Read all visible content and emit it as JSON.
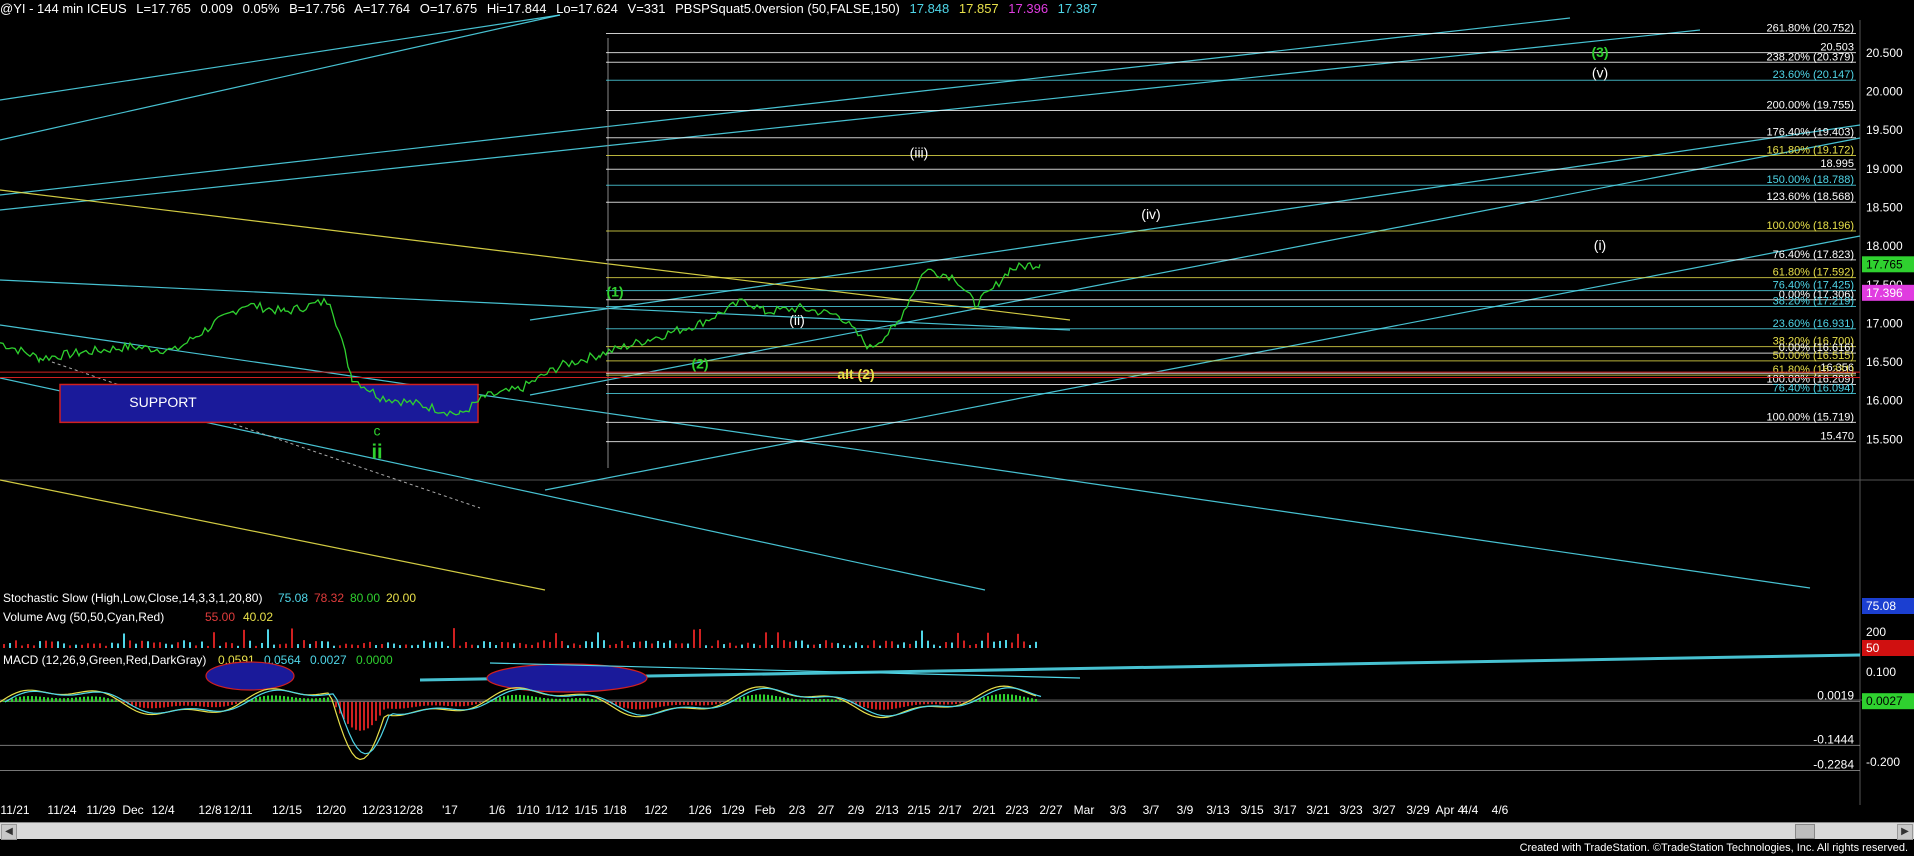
{
  "header": {
    "symbol": "@YI - 144 min  ICEUS",
    "last": "L=17.765",
    "change": "0.009",
    "pct": "0.05%",
    "bid": "B=17.756",
    "ask": "A=17.764",
    "open": "O=17.675",
    "high": "Hi=17.844",
    "low": "Lo=17.624",
    "volume": "V=331",
    "study": "PBSPSquat5.0version (50,FALSE,150)",
    "v1": "17.848",
    "v2": "17.857",
    "v3": "17.396",
    "v4": "17.387"
  },
  "colors": {
    "background": "#000000",
    "cyan": "#4fd6e8",
    "yellow": "#e8e04a",
    "olive": "#c8b85a",
    "green": "#2fd12f",
    "magenta": "#e03ce0",
    "red": "#d02020",
    "blue_box": "#1a1a9a",
    "white": "#ffffff"
  },
  "chart_data": [
    {
      "type": "line",
      "panel": "price",
      "y_axis_labels": [
        "20.500",
        "20.000",
        "19.500",
        "19.000",
        "18.500",
        "18.000",
        "17.500",
        "17.000",
        "16.500",
        "16.000",
        "15.500"
      ],
      "ylim": [
        15.0,
        20.9
      ],
      "x_labels": [
        "11/21",
        "11/24",
        "11/29",
        "Dec",
        "12/4",
        "12/8",
        "12/11",
        "12/15",
        "12/20",
        "12/23",
        "12/28",
        "'17",
        "1/6",
        "1/10",
        "1/12",
        "1/15",
        "1/18",
        "1/22",
        "1/26",
        "1/29",
        "Feb",
        "2/3",
        "2/7",
        "2/9",
        "2/13",
        "2/15",
        "2/17",
        "2/21",
        "2/23",
        "2/27",
        "Mar",
        "3/3",
        "3/7",
        "3/9",
        "3/13",
        "3/15",
        "3/17",
        "3/21",
        "3/23",
        "3/27",
        "3/29",
        "Apr 4",
        "4/4",
        "4/6"
      ],
      "fib_levels": [
        {
          "label": "261.80% (20.752)",
          "value": 20.752,
          "color": "#ffffff"
        },
        {
          "label": "20.503",
          "value": 20.503,
          "color": "#ffffff"
        },
        {
          "label": "238.20% (20.379)",
          "value": 20.379,
          "color": "#ffffff"
        },
        {
          "label": "23.60% (20.147)",
          "value": 20.147,
          "color": "#4fd6e8"
        },
        {
          "label": "200.00% (19.755)",
          "value": 19.755,
          "color": "#ffffff"
        },
        {
          "label": "176.40% (19.403)",
          "value": 19.403,
          "color": "#ffffff"
        },
        {
          "label": "161.80% (19.172)",
          "value": 19.172,
          "color": "#e8e04a"
        },
        {
          "label": "18.995",
          "value": 18.995,
          "color": "#ffffff"
        },
        {
          "label": "150.00% (18.788)",
          "value": 18.788,
          "color": "#4fd6e8"
        },
        {
          "label": "123.60% (18.568)",
          "value": 18.568,
          "color": "#ffffff"
        },
        {
          "label": "100.00% (18.196)",
          "value": 18.196,
          "color": "#e8e04a"
        },
        {
          "label": "76.40% (17.823)",
          "value": 17.823,
          "color": "#ffffff"
        },
        {
          "label": "61.80% (17.592)",
          "value": 17.592,
          "color": "#e8e04a"
        },
        {
          "label": "76.40% (17.425)",
          "value": 17.425,
          "color": "#4fd6e8"
        },
        {
          "label": "0.00% (17.306)",
          "value": 17.306,
          "color": "#ffffff"
        },
        {
          "label": "38.20% (17.219)",
          "value": 17.219,
          "color": "#4fd6e8"
        },
        {
          "label": "23.60% (16.931)",
          "value": 16.931,
          "color": "#4fd6e8"
        },
        {
          "label": "38.20% (16.700)",
          "value": 16.7,
          "color": "#e8e04a"
        },
        {
          "label": "0.00% (16.616)",
          "value": 16.616,
          "color": "#ffffff"
        },
        {
          "label": "50.00% (16.515)",
          "value": 16.515,
          "color": "#e8e04a"
        },
        {
          "label": "16.356",
          "value": 16.356,
          "color": "#ffffff"
        },
        {
          "label": "61.80% (16.331)",
          "value": 16.331,
          "color": "#e8e04a"
        },
        {
          "label": "100.00% (16.209)",
          "value": 16.209,
          "color": "#ffffff"
        },
        {
          "label": "76.40% (16.094)",
          "value": 16.094,
          "color": "#4fd6e8"
        },
        {
          "label": "100.00% (15.719)",
          "value": 15.719,
          "color": "#ffffff"
        },
        {
          "label": "15.470",
          "value": 15.47,
          "color": "#ffffff"
        }
      ],
      "price_tags": [
        {
          "label": "17.765",
          "value": 17.765,
          "bg": "#2fd12f",
          "fg": "#000000"
        },
        {
          "label": "17.396",
          "value": 17.396,
          "bg": "#e03ce0",
          "fg": "#ffffff"
        }
      ],
      "annotations": [
        {
          "text": "(3)",
          "color": "#2fd12f",
          "x_date": "4/2",
          "y": 20.45
        },
        {
          "text": "(v)",
          "color": "#ffffff",
          "x_date": "4/2",
          "y": 20.18
        },
        {
          "text": "(iii)",
          "color": "#ffffff",
          "x_date": "2/15",
          "y": 19.15
        },
        {
          "text": "(iv)",
          "color": "#ffffff",
          "x_date": "3/7",
          "y": 18.35
        },
        {
          "text": "(i)",
          "color": "#ffffff",
          "x_date": "1/30",
          "y": 17.95
        },
        {
          "text": "(ii)",
          "color": "#ffffff",
          "x_date": "2/3",
          "y": 16.98
        },
        {
          "text": "(1)",
          "color": "#2fd12f",
          "x_date": "1/18",
          "y": 17.35
        },
        {
          "text": "(2)",
          "color": "#2fd12f",
          "x_date": "1/26",
          "y": 16.42
        },
        {
          "text": "alt (2)",
          "color": "#e8e04a",
          "x_date": "2/9",
          "y": 16.28
        },
        {
          "text": "c",
          "color": "#2fd12f",
          "x_date": "12/23",
          "y": 15.55
        },
        {
          "text": "ii",
          "color": "#2fd12f",
          "x_date": "12/23",
          "y": 15.25
        },
        {
          "text": "SUPPORT",
          "color": "#ffffff",
          "x_date": "12/4",
          "y": 15.92
        }
      ]
    },
    {
      "type": "line",
      "panel": "stochastic",
      "title": "Stochastic Slow (High,Low,Close,14,3,3,1,20,80)",
      "values_text": [
        "75.08",
        "78.32",
        "80.00",
        "20.00"
      ],
      "axis_tag": "75.08"
    },
    {
      "type": "bar",
      "panel": "volume",
      "title": "Volume Avg (50,50,Cyan,Red)",
      "values_text": [
        "55.00",
        "40.02"
      ],
      "y_axis_labels": [
        "200",
        "50"
      ]
    },
    {
      "type": "line",
      "panel": "macd",
      "title": "MACD (12,26,9,Green,Red,DarkGray)",
      "values_text": [
        "0.0591",
        "0.0564",
        "0.0027",
        "0.0000"
      ],
      "y_axis_labels": [
        "0.100",
        "-0.200"
      ],
      "ylim": [
        -0.26,
        0.14
      ],
      "levels": [
        {
          "label": "0.0019",
          "value": 0.0019
        },
        {
          "label": "-0.1444",
          "value": -0.1444
        },
        {
          "label": "-0.2284",
          "value": -0.2284
        }
      ],
      "axis_tag": "0.0027"
    }
  ],
  "footer": "Created with TradeStation. ©TradeStation Technologies, Inc. All rights reserved."
}
